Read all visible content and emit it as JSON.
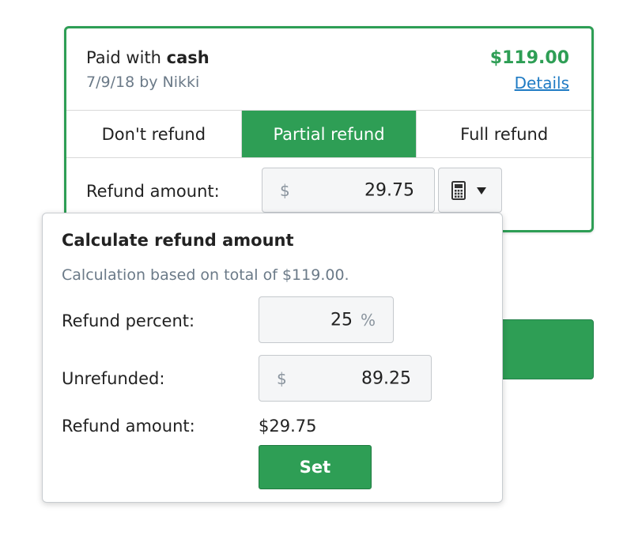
{
  "payment": {
    "paid_prefix": "Paid with",
    "method": "cash",
    "date_by": "7/9/18 by Nikki",
    "total": "$119.00",
    "details_link": "Details"
  },
  "tabs": [
    {
      "label": "Don't refund",
      "active": false
    },
    {
      "label": "Partial refund",
      "active": true
    },
    {
      "label": "Full refund",
      "active": false
    }
  ],
  "refund": {
    "label": "Refund amount:",
    "currency": "$",
    "value": "29.75",
    "calculator_icon": "calculator-icon",
    "dropdown_icon": "caret-down-icon"
  },
  "calculator": {
    "title": "Calculate refund amount",
    "subtitle": "Calculation based on total of $119.00.",
    "percent_label": "Refund percent:",
    "percent_value": "25",
    "percent_symbol": "%",
    "unrefunded_label": "Unrefunded:",
    "unrefunded_currency": "$",
    "unrefunded_value": "89.25",
    "refund_amount_label": "Refund amount:",
    "refund_amount_value": "$29.75",
    "set_label": "Set"
  },
  "colors": {
    "accent_green": "#2e9e55",
    "link_blue": "#1f7bc4",
    "muted_text": "#6b7a88"
  }
}
